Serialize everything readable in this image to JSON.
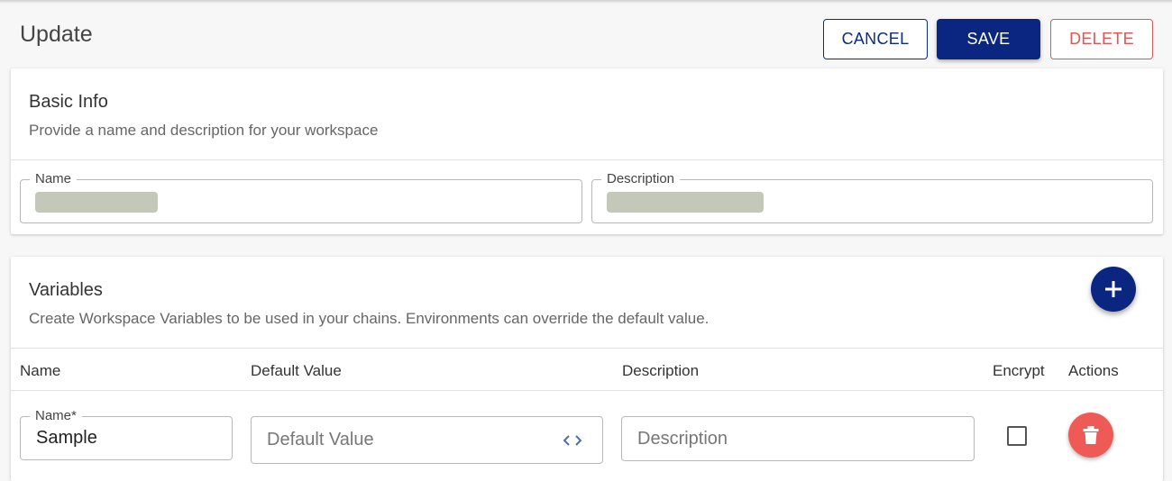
{
  "header": {
    "title": "Update",
    "cancel_label": "CANCEL",
    "save_label": "SAVE",
    "delete_label": "DELETE"
  },
  "basic_info": {
    "title": "Basic Info",
    "subtitle": "Provide a name and description for your workspace",
    "name_label": "Name",
    "description_label": "Description"
  },
  "variables": {
    "title": "Variables",
    "subtitle": "Create Workspace Variables to be used in your chains. Environments can override the default value.",
    "add_icon": "plus-icon",
    "columns": [
      "Name",
      "Default Value",
      "Description",
      "Encrypt",
      "Actions"
    ],
    "rows": [
      {
        "name_label": "Name*",
        "name_value": "Sample",
        "default_value_placeholder": "Default Value",
        "description_placeholder": "Description",
        "encrypt": false,
        "code_icon": "code-icon",
        "delete_icon": "trash-icon"
      }
    ]
  },
  "colors": {
    "primary": "#0b2680",
    "danger": "#e55454",
    "redaction": "#c3c8b9"
  }
}
